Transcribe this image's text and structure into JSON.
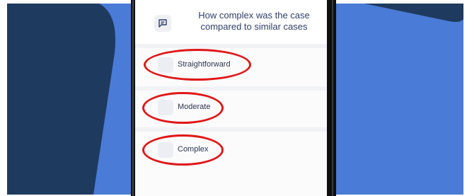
{
  "question": {
    "icon": "message-icon",
    "text": "How complex was the case compared to similar cases"
  },
  "options": [
    {
      "label": "Straightforward"
    },
    {
      "label": "Moderate"
    },
    {
      "label": "Complex"
    }
  ],
  "colors": {
    "annotation": "#e01818",
    "background_blue": "#4a7bd6",
    "background_navy": "#1e3a5f",
    "text": "#2f3e6a"
  }
}
